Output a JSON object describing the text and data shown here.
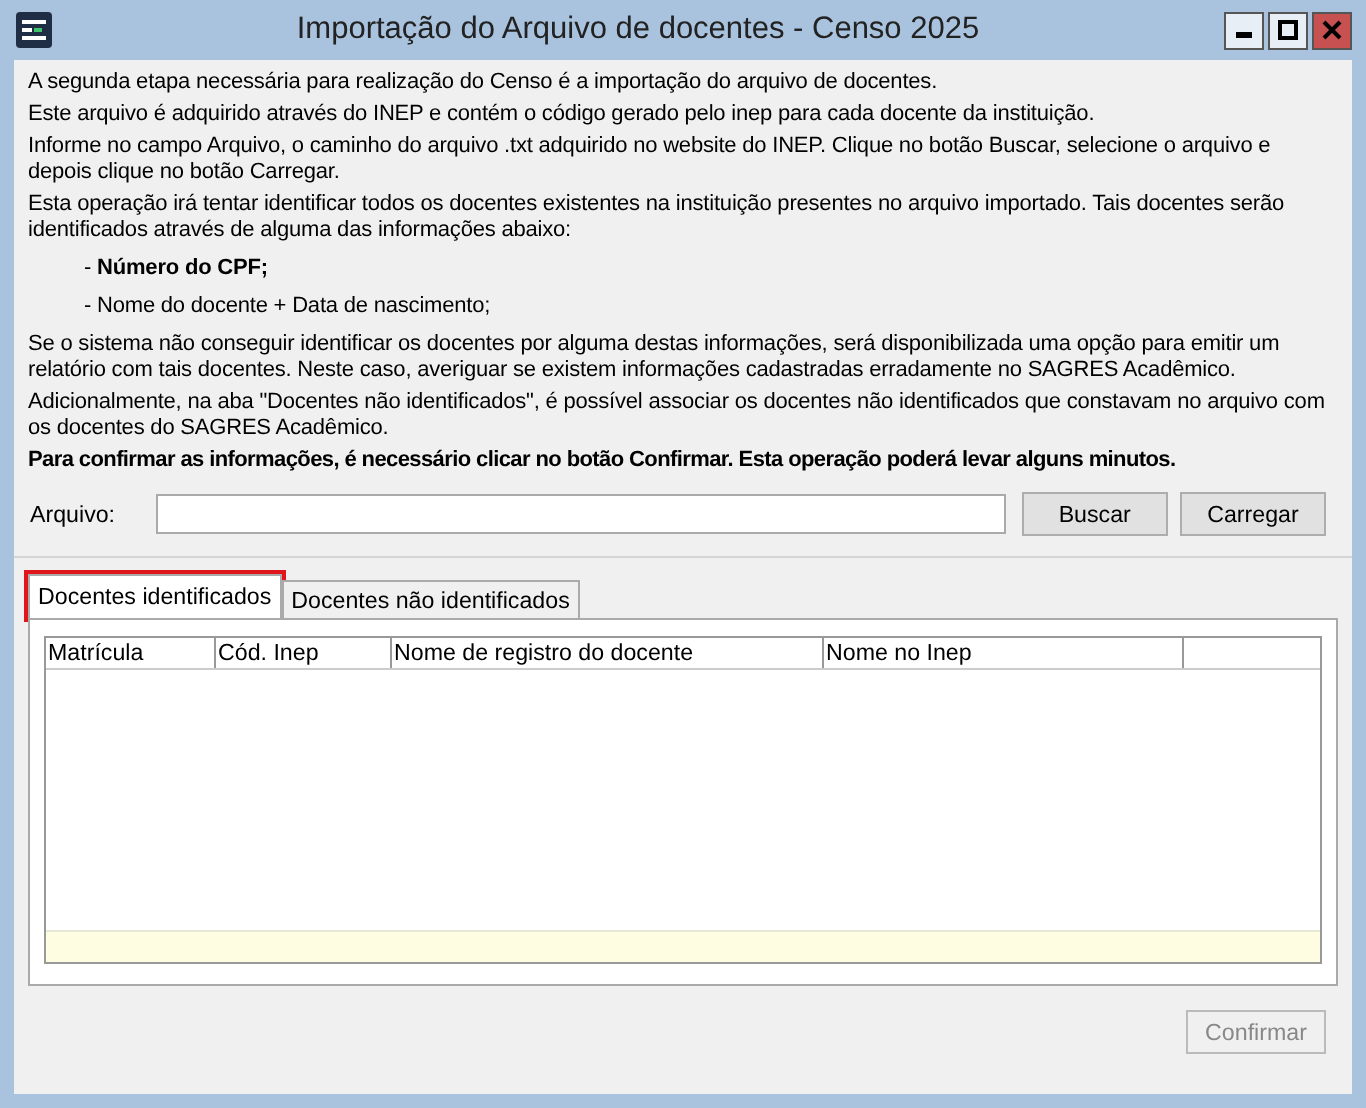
{
  "window": {
    "title": "Importação do Arquivo de docentes - Censo 2025"
  },
  "instructions": [
    {
      "kind": "para",
      "text": "A segunda etapa necessária para realização do Censo é a importação do arquivo de docentes."
    },
    {
      "kind": "para",
      "text": "Este arquivo é adquirido através do INEP e contém o código gerado pelo inep para cada docente da instituição."
    },
    {
      "kind": "para",
      "text": "Informe no campo Arquivo, o caminho do arquivo .txt adquirido no website do INEP. Clique no botão Buscar, selecione o arquivo e depois clique no botão Carregar."
    },
    {
      "kind": "para",
      "text": "Esta operação irá tentar identificar todos os docentes existentes na instituição presentes no arquivo importado. Tais docentes serão identificados através de alguma das informações abaixo:"
    },
    {
      "kind": "bullet",
      "text": "- **Número do CPF;**"
    },
    {
      "kind": "bullet",
      "text": "- Nome do docente + Data de nascimento;"
    },
    {
      "kind": "para",
      "text": "Se o sistema não conseguir identificar os docentes por alguma destas informações, será disponibilizada uma opção para emitir um relatório com tais docentes. Neste caso, averiguar se existem informações cadastradas erradamente no SAGRES Acadêmico."
    },
    {
      "kind": "para",
      "text": "Adicionalmente, na aba \"Docentes não identificados\", é possível associar os docentes não identificados que constavam no arquivo com os docentes do SAGRES Acadêmico."
    },
    {
      "kind": "strong",
      "text": "Para confirmar as informações, é necessário clicar no botão Confirmar. Esta operação poderá levar alguns minutos."
    }
  ],
  "file_field": {
    "label": "Arquivo:",
    "buttons": [
      "Buscar",
      "Carregar"
    ]
  },
  "tabs": [
    {
      "label": "Docentes identificados",
      "selected": true
    },
    {
      "label": "Docentes não identificados",
      "selected": false
    }
  ],
  "table": {
    "columns": [
      "Matrícula",
      "Cód. Inep",
      "Nome de registro do docente",
      "Nome no Inep"
    ]
  },
  "confirm_button": {
    "label": "Confirmar",
    "disabled": true
  }
}
